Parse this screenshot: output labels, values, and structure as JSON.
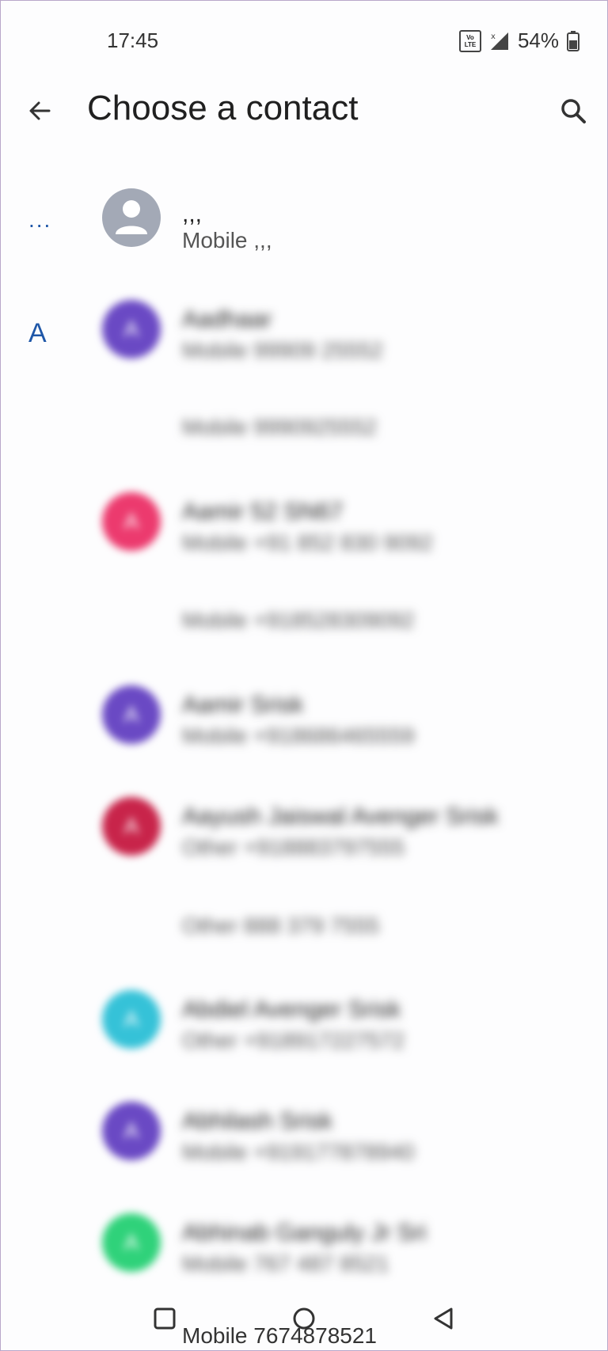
{
  "status": {
    "time": "17:45",
    "volte_top": "Vo",
    "volte_bottom": "LTE",
    "battery": "54%"
  },
  "header": {
    "title": "Choose a contact",
    "back_icon": "arrow-back-icon",
    "search_icon": "search-icon"
  },
  "sections": {
    "misc_label": "...",
    "a_label": "A"
  },
  "contacts": [
    {
      "name": ",,,",
      "phone": "Mobile ,,,",
      "avatar_color": "#a3a9b6",
      "avatar_letter": ""
    },
    {
      "name": "Aadhaar",
      "phone": "Mobile 99909 25552",
      "avatar_color": "#6a49c4",
      "avatar_letter": "A"
    },
    {
      "name": "",
      "phone": "Mobile 9990925552",
      "avatar_color": "",
      "avatar_letter": ""
    },
    {
      "name": "Aamir 52 SN67",
      "phone": "Mobile +91 852 830 9092",
      "avatar_color": "#ec3a6e",
      "avatar_letter": "A"
    },
    {
      "name": "",
      "phone": "Mobile +918528309092",
      "avatar_color": "",
      "avatar_letter": ""
    },
    {
      "name": "Aamir Srisk",
      "phone": "Mobile +918686465559",
      "avatar_color": "#6a49c4",
      "avatar_letter": "A"
    },
    {
      "name": "Aayush Jaiswal Avenger Srisk",
      "phone": "Other +918883797555",
      "avatar_color": "#c8244a",
      "avatar_letter": "A"
    },
    {
      "name": "",
      "phone": "Other 888 379 7555",
      "avatar_color": "",
      "avatar_letter": ""
    },
    {
      "name": "Abdiel Avenger Srisk",
      "phone": "Other +918917227572",
      "avatar_color": "#35c2d8",
      "avatar_letter": "A"
    },
    {
      "name": "Abhilash Srisk",
      "phone": "Mobile +919177878940",
      "avatar_color": "#6a49c4",
      "avatar_letter": "A"
    },
    {
      "name": "Abhinab Ganguly Jr Sri",
      "phone": "Mobile 767 487 8521",
      "avatar_color": "#2fd27a",
      "avatar_letter": "A"
    }
  ],
  "bottom": {
    "peek_text": "Mobile 7674878521"
  },
  "nav": {
    "recents_icon": "square-recents-icon",
    "home_icon": "circle-home-icon",
    "back_icon": "triangle-back-icon"
  }
}
